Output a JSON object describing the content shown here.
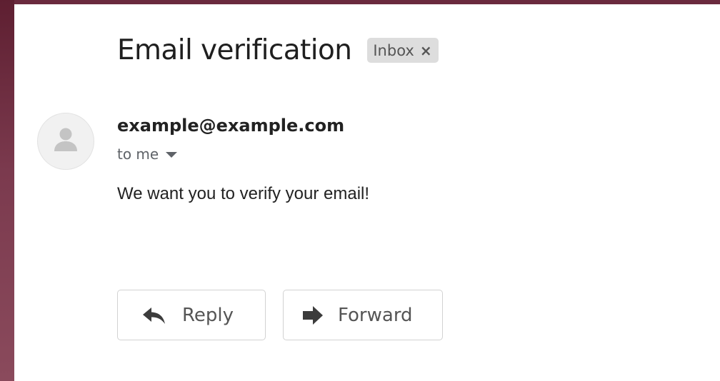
{
  "email": {
    "subject": "Email verification",
    "label": {
      "name": "Inbox",
      "remove_symbol": "×"
    },
    "sender": "example@example.com",
    "recipient": "to me",
    "body": "We want you to verify your email!"
  },
  "actions": {
    "reply_label": "Reply",
    "forward_label": "Forward"
  },
  "icons": {
    "avatar": "person-icon",
    "recipient_details": "caret-down-icon",
    "reply": "reply-arrow-icon",
    "forward": "forward-arrow-icon"
  },
  "colors": {
    "background_window": "#7a3a4d",
    "card": "#ffffff",
    "label_chip": "#dddddd",
    "text_primary": "#222222",
    "text_secondary": "#5f6368",
    "button_border": "#d2d2d2"
  }
}
